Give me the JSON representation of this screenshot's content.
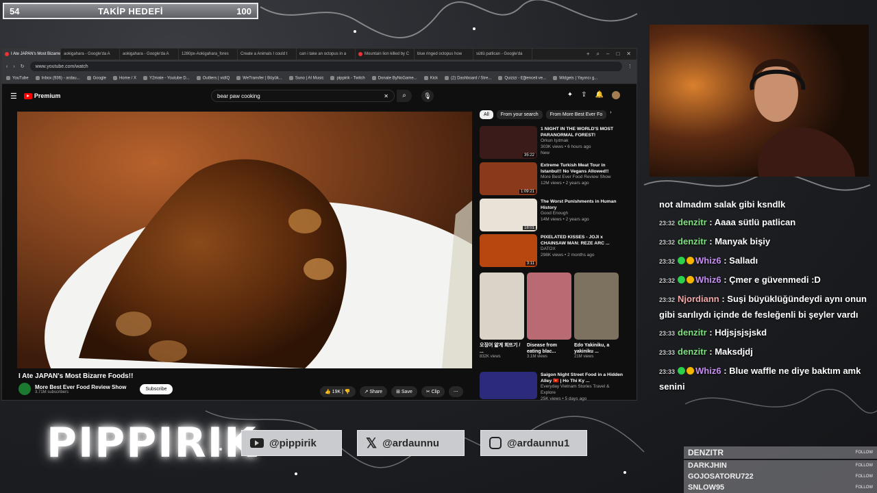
{
  "goal": {
    "current": "54",
    "label": "TAKİP HEDEFİ",
    "target": "100"
  },
  "browser": {
    "tabs": [
      "I Ate JAPAN's Most Bizarre",
      "aokigahara - Google'da A",
      "aokigahara - Google'da A",
      "1280px-Aokigahara_fores",
      "Create a Animals I could t",
      "can i take an octopus in a",
      "Mountain lion killed by C",
      "blue ringed octopus how",
      "sütlü patlican - Google'da"
    ],
    "url": "www.youtube.com/watch",
    "bookmarks": [
      "YouTube",
      "Inbox (936) - ardau...",
      "Google",
      "Home / X",
      "Y2mate - Youtube D...",
      "Outliers | vidIQ",
      "WeTransfer | Büyük...",
      "Suno | AI Music",
      "pippirik - Twitch",
      "Donate ByNoGame...",
      "Kick",
      "(2) Dashboard / Stre...",
      "Quizizi - Eğlenceli ve...",
      "Widgets | Yayıncı g..."
    ]
  },
  "youtube": {
    "logo": "Premium",
    "search_value": "bear paw cooking",
    "video_title": "I Ate JAPAN's Most Bizarre Foods!!",
    "channel": "More Best Ever Food Review Show",
    "subscribers": "3.71M subscribers",
    "subscribe": "Subscribe",
    "likes": "19K",
    "share": "Share",
    "save": "Save",
    "clip": "Clip",
    "chips": [
      "All",
      "From your search",
      "From More Best Ever Fo"
    ],
    "recs": [
      {
        "title": "1 NIGHT IN THE WORLD'S MOST PARANORMAL FOREST!",
        "channel": "Orkun Işıtmak",
        "meta": "303K views • 6 hours ago",
        "badge": "New",
        "dur": "35:22",
        "color": "#3b1a1a"
      },
      {
        "title": "Extreme Turkish Meat Tour in Istanbul!! No Vegans Allowed!!",
        "channel": "More Best Ever Food Review Show",
        "meta": "12M views • 2 years ago",
        "dur": "1:09:21",
        "color": "#8a3a1a"
      },
      {
        "title": "The Worst Punishments in Human History",
        "channel": "Good Enough",
        "meta": "14M views • 2 years ago",
        "dur": "18:01",
        "color": "#e8e3d6"
      },
      {
        "title": "PIXELATED KISSES - JOJI x CHAINSAW MAN: REZE ARC ...",
        "channel": "DATOX",
        "meta": "298K views • 2 months ago",
        "dur": "3:11",
        "color": "#b8460f"
      }
    ],
    "shorts": [
      {
        "title": "오징어 얇게 회뜨기 / ...",
        "views": "832K views"
      },
      {
        "title": "Disease from eating blac...",
        "views": "3.1M views"
      },
      {
        "title": "Edo Yakiniku, a yakiniku ...",
        "views": "21M views"
      }
    ],
    "last_rec": {
      "title": "Saigon Night Street Food in a Hidden Alley 🇻🇳 | Ho Thi Ky ...",
      "channel": "Everyday Vietnam Stories Travel & Explore",
      "meta": "25K views • 5 days ago"
    }
  },
  "chat": [
    {
      "time": "",
      "user": "",
      "text": "not almadım salak gibi ksndlk",
      "color": "#ffffff",
      "badge": false
    },
    {
      "time": "23:32",
      "user": "denzitr",
      "text": ": Aaaa sütlü patlican",
      "color": "#7fe07f",
      "badge": false
    },
    {
      "time": "23:32",
      "user": "denzitr",
      "text": ": Manyak bişiy",
      "color": "#7fe07f",
      "badge": false
    },
    {
      "time": "23:32",
      "user": "Whiz6",
      "text": ": Salladı",
      "color": "#c58cf0",
      "badge": true
    },
    {
      "time": "23:32",
      "user": "Whiz6",
      "text": ": Çmer e güvenmedi :D",
      "color": "#c58cf0",
      "badge": true
    },
    {
      "time": "23:32",
      "user": "Njordiann",
      "text": ": Suşi büyüklüğündeydi aynı onun gibi sarılıydı içinde de fesleğenli bi şeyler vardı",
      "color": "#f0a8a8",
      "badge": false
    },
    {
      "time": "23:33",
      "user": "denzitr",
      "text": ": Hdjsjsjsjskd",
      "color": "#7fe07f",
      "badge": false
    },
    {
      "time": "23:33",
      "user": "denzitr",
      "text": ": Maksdjdj",
      "color": "#7fe07f",
      "badge": false
    },
    {
      "time": "23:33",
      "user": "Whiz6",
      "text": ": Blue waffle ne diye baktım amk senini",
      "color": "#c58cf0",
      "badge": true
    }
  ],
  "socials": {
    "youtube": "@pippirik",
    "x": "@ardaunnu",
    "instagram": "@ardaunnu1"
  },
  "brand": "PIPPIRIK",
  "followers": {
    "label": "FOLLOW",
    "names": [
      "DENZITR",
      "DARKJHIN",
      "GOJOSATORU722",
      "SNLOW95"
    ]
  }
}
